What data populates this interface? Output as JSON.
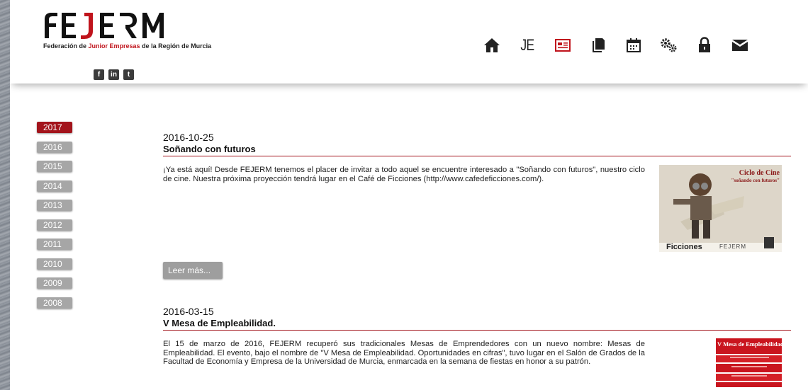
{
  "brand": {
    "logo_text": "FEJERM",
    "tagline_pre": "Federación de ",
    "tagline_red": "Junior Empresas",
    "tagline_post": " de la Región de Murcia"
  },
  "social": [
    {
      "name": "facebook-icon",
      "glyph": "f"
    },
    {
      "name": "linkedin-icon",
      "glyph": "in"
    },
    {
      "name": "twitter-icon",
      "glyph": "t"
    }
  ],
  "nav": {
    "je_label": "JE",
    "active_color": "#c0141c",
    "icon_color": "#222222"
  },
  "years": [
    "2017",
    "2016",
    "2015",
    "2014",
    "2013",
    "2012",
    "2011",
    "2010",
    "2009",
    "2008"
  ],
  "articles": [
    {
      "date": "2016-10-25",
      "title": "Soñando con futuros",
      "body": "¡Ya está aquí! Desde FEJERM tenemos el placer de invitar a todo aquel se encuentre interesado a \"Soñando con futuros\", nuestro ciclo de cine. Nuestra próxima proyección tendrá lugar en el Café de Ficciones (http://www.cafedeficciones.com/).",
      "more": "Leer  más...",
      "thumb": {
        "heading": "Ciclo de Cine",
        "sub": "\"soñando con futuros\"",
        "brand": "Ficciones",
        "logo": "FEJERM"
      }
    },
    {
      "date": "2016-03-15",
      "title": "V Mesa de Empleabilidad.",
      "body": "El 15 de marzo de 2016, FEJERM recuperó sus tradicionales Mesas de Emprendedores con un nuevo nombre: Mesas de Empleabilidad. El evento, bajo el nombre de \"V Mesa de Empleabilidad. Oportunidades en cifras\", tuvo lugar en el Salón de Grados de la Facultad de Economía y Empresa de la Universidad de Murcia, enmarcada en la semana de fiestas en honor a su patrón.",
      "thumb": {
        "heading": "V Mesa de Empleabilidad"
      }
    }
  ]
}
